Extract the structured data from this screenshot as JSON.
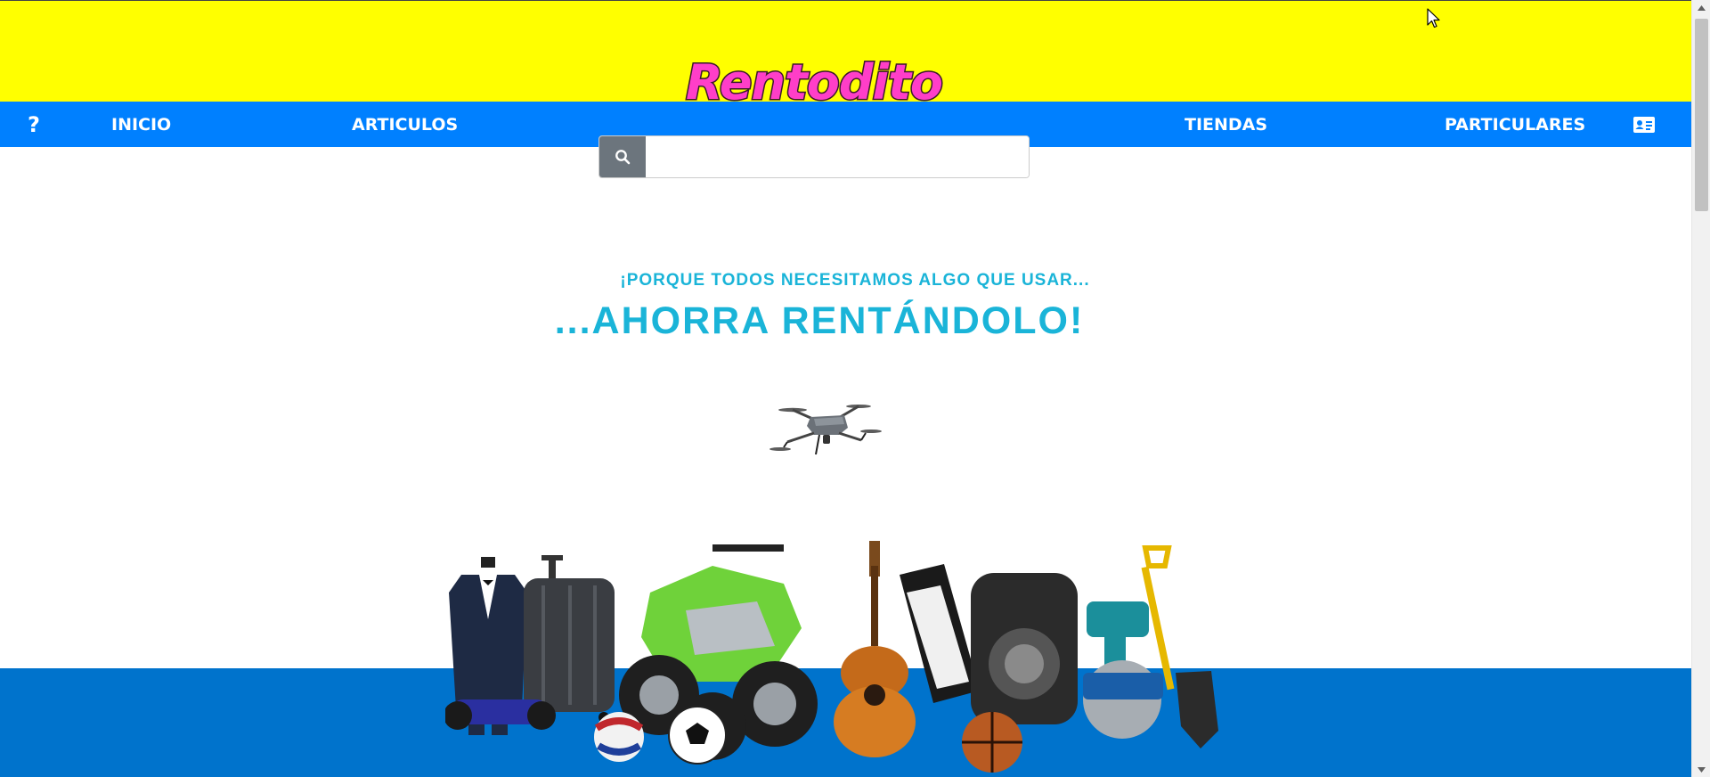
{
  "brand": {
    "logo_text": "Rentodito"
  },
  "nav": {
    "help_label": "?",
    "items": [
      {
        "label": "INICIO"
      },
      {
        "label": "ARTICULOS"
      },
      {
        "label": "TIENDAS"
      },
      {
        "label": "PARTICULARES"
      }
    ],
    "card_icon": "address-card-icon"
  },
  "search": {
    "value": "",
    "placeholder": "",
    "icon": "search-icon"
  },
  "hero": {
    "tagline_small": "¡PORQUE TODOS NECESITAMOS ALGO QUE USAR...",
    "tagline_large": "...AHORRA RENTÁNDOLO!"
  },
  "colors": {
    "top_band": "#ffff00",
    "nav_bar": "#0080ff",
    "bottom_band": "#0073cc",
    "tagline": "#1ab4d8",
    "logo": "#ff3ec8",
    "search_button": "#6c757d"
  }
}
